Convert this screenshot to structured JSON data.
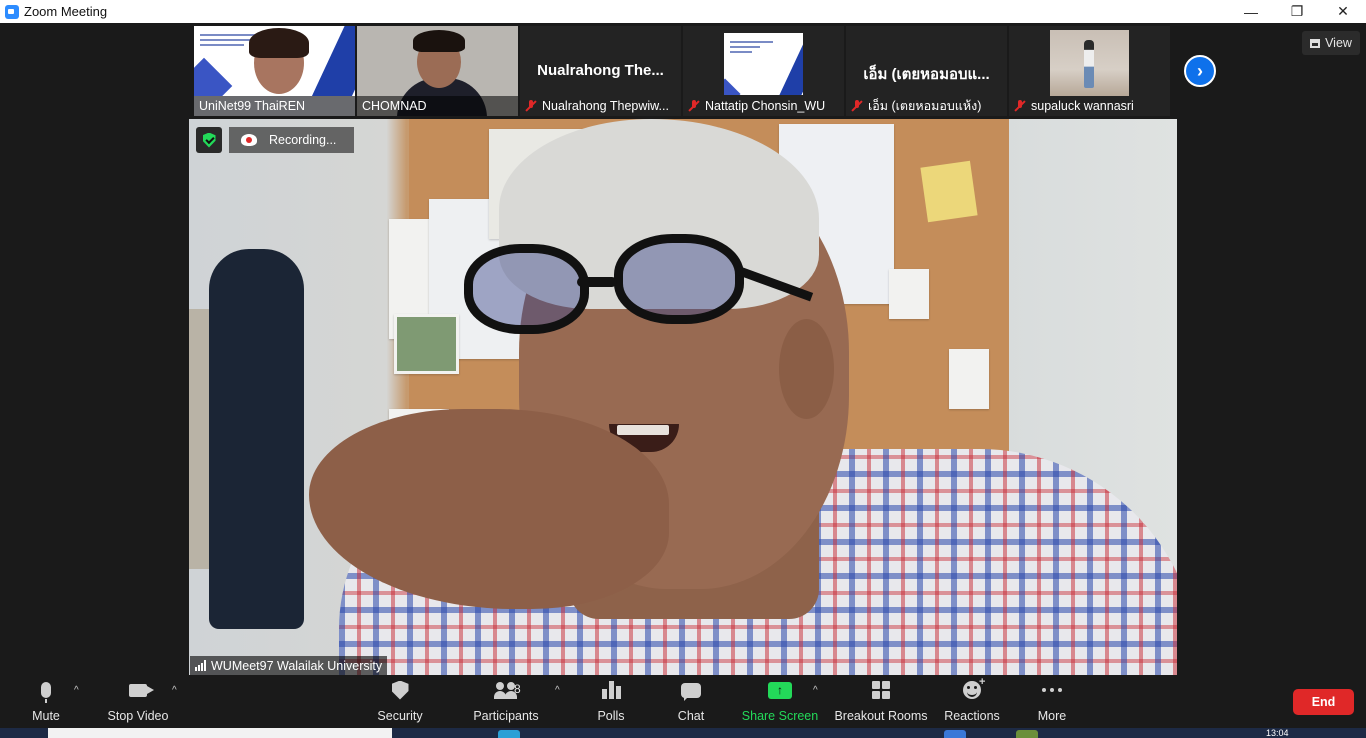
{
  "window": {
    "title": "Zoom Meeting",
    "minimize": "—",
    "restore": "❐",
    "close": "✕"
  },
  "gallery": {
    "tiles": [
      {
        "name": "UniNet99 ThaiREN",
        "muted": false,
        "display_name": ""
      },
      {
        "name": "CHOMNAD",
        "muted": false,
        "display_name": ""
      },
      {
        "name": "Nualrahong Thepwiw...",
        "muted": true,
        "display_name": "Nualrahong  The..."
      },
      {
        "name": "Nattatip Chonsin_WU",
        "muted": true,
        "display_name": ""
      },
      {
        "name": "เอ็ม (เตยหอมอบแห้ง)",
        "muted": true,
        "display_name": "เอ็ม (เตยหอมอบแ..."
      },
      {
        "name": "supaluck wannasri",
        "muted": true,
        "display_name": ""
      }
    ],
    "next_icon": "›",
    "view_label": "View"
  },
  "speaker": {
    "recording_label": "Recording...",
    "name": "WUMeet97 Walailak University"
  },
  "toolbar": {
    "mute_label": "Mute",
    "stop_video_label": "Stop Video",
    "security_label": "Security",
    "participants_label": "Participants",
    "participants_count": "8",
    "polls_label": "Polls",
    "chat_label": "Chat",
    "share_screen_label": "Share Screen",
    "share_arrow": "↑",
    "breakout_rooms_label": "Breakout Rooms",
    "reactions_label": "Reactions",
    "reactions_plus": "+",
    "more_label": "More",
    "end_label": "End",
    "caret": "^"
  },
  "taskbar": {
    "clock": "13:04"
  },
  "colors": {
    "accent_blue": "#0e71eb",
    "share_green": "#23d959",
    "end_red": "#e02828",
    "mute_red": "#e02828"
  }
}
